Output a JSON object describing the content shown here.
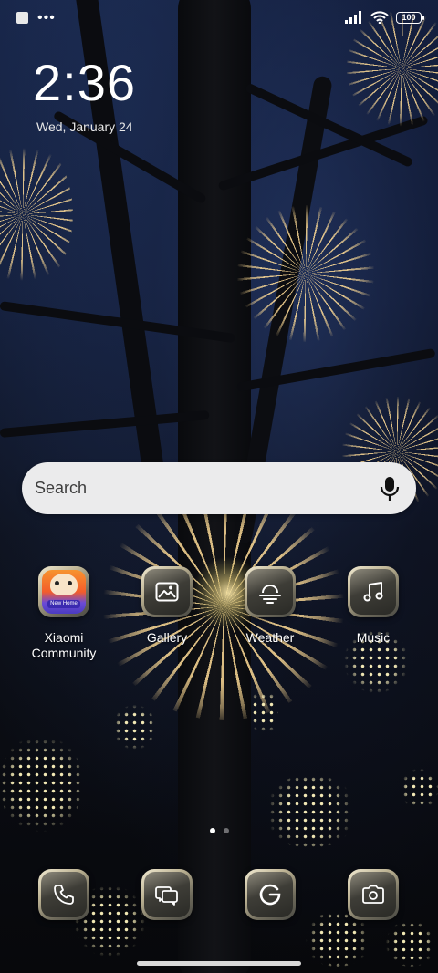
{
  "status_bar": {
    "battery": "100",
    "left_icons": [
      "notification-square-icon",
      "more-dots-icon"
    ],
    "right_icons": [
      "signal-icon",
      "wifi-icon",
      "battery-icon"
    ]
  },
  "clock": {
    "time": "2:36",
    "date": "Wed, January 24"
  },
  "search": {
    "placeholder": "Search",
    "mic_icon": "microphone-icon"
  },
  "apps": [
    {
      "label": "Xiaomi Community",
      "icon": "xiaomi-community-icon"
    },
    {
      "label": "Gallery",
      "icon": "gallery-icon"
    },
    {
      "label": "Weather",
      "icon": "weather-icon"
    },
    {
      "label": "Music",
      "icon": "music-note-icon"
    }
  ],
  "page_indicator": {
    "pages": 2,
    "current": 1
  },
  "dock": [
    {
      "icon": "phone-icon"
    },
    {
      "icon": "messages-icon"
    },
    {
      "icon": "google-icon"
    },
    {
      "icon": "camera-icon"
    }
  ],
  "community_badge_text": "New Home"
}
